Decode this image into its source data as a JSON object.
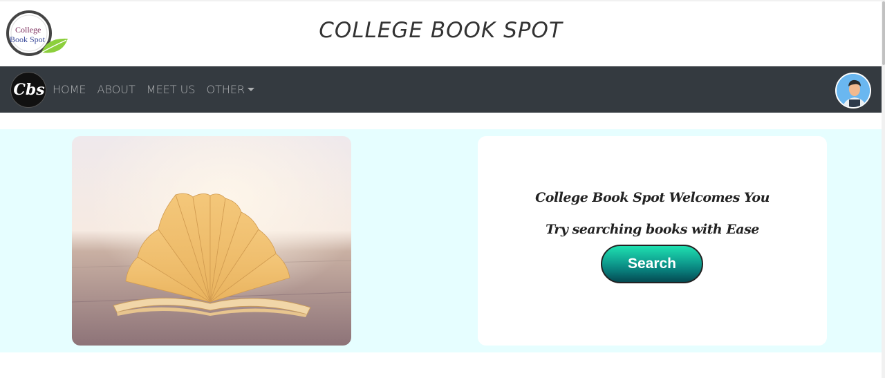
{
  "header": {
    "logo_text_line1": "College",
    "logo_text_line2": "Book Spot",
    "title": "COLLEGE BOOK SPOT"
  },
  "navbar": {
    "brand_text": "Cbs",
    "links": [
      {
        "label": "HOME"
      },
      {
        "label": "ABOUT"
      },
      {
        "label": "MEET US"
      },
      {
        "label": "OTHER"
      }
    ]
  },
  "hero": {
    "welcome": "College Book Spot Welcomes You",
    "tagline": "Try searching books with Ease",
    "search_label": "Search"
  },
  "colors": {
    "navbar_bg": "#343a40",
    "hero_bg": "#e6feff",
    "button_accent": "#0fa090"
  }
}
